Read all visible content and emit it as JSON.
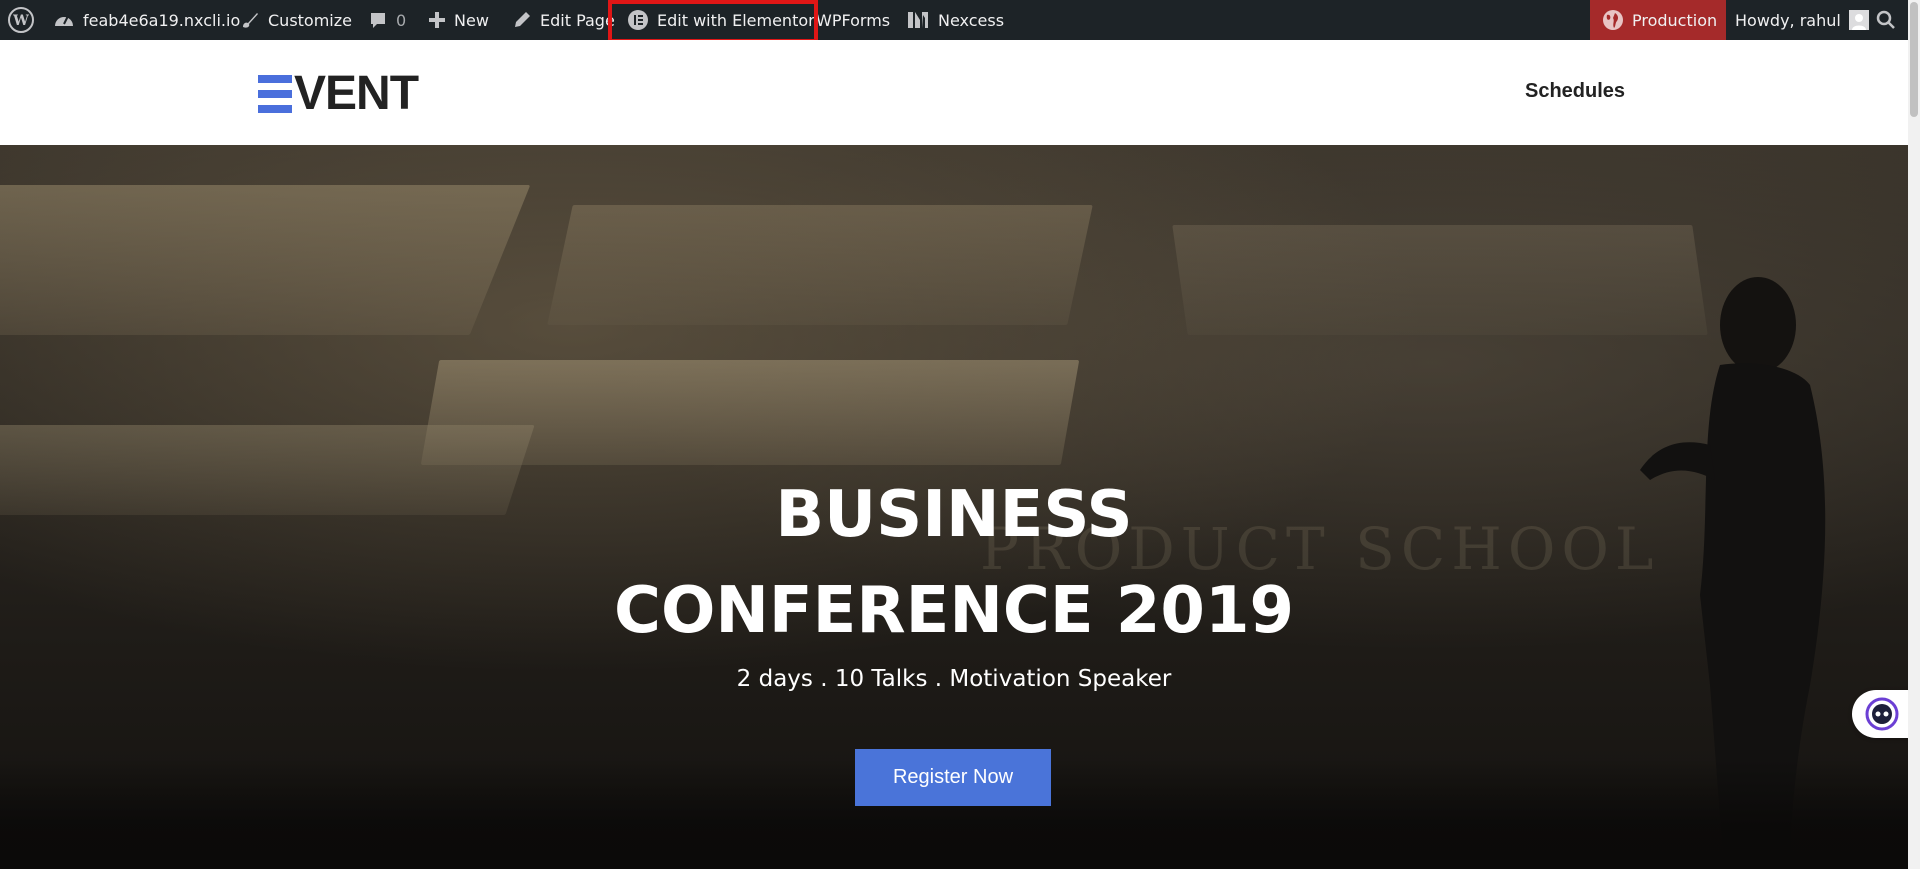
{
  "admin_bar": {
    "site_name": "feab4e6a19.nxcli.io",
    "customize": "Customize",
    "comments_count": "0",
    "new": "New",
    "edit_page": "Edit Page",
    "edit_with_elementor": "Edit with Elementor",
    "wpforms": "WPForms",
    "nexcess": "Nexcess",
    "environment": "Production",
    "greeting": "Howdy, rahul",
    "icons": [
      "wordpress-icon",
      "dashboard-icon",
      "brush-icon",
      "comment-icon",
      "plus-icon",
      "pencil-icon",
      "elementor-icon",
      "nexcess-icon",
      "globe-icon",
      "avatar",
      "search-icon"
    ]
  },
  "header": {
    "logo_text": "VENT",
    "nav": [
      "Schedules"
    ]
  },
  "hero": {
    "title_line1": "BUSINESS",
    "title_line2": "CONFERENCE 2019",
    "subtitle": "2 days . 10 Talks . Motivation Speaker",
    "cta": "Register Now"
  },
  "colors": {
    "admin_bar_bg": "#1d2327",
    "production_badge": "#a52a2a",
    "highlight": "#e01616",
    "brand_blue": "#4a74d9"
  }
}
